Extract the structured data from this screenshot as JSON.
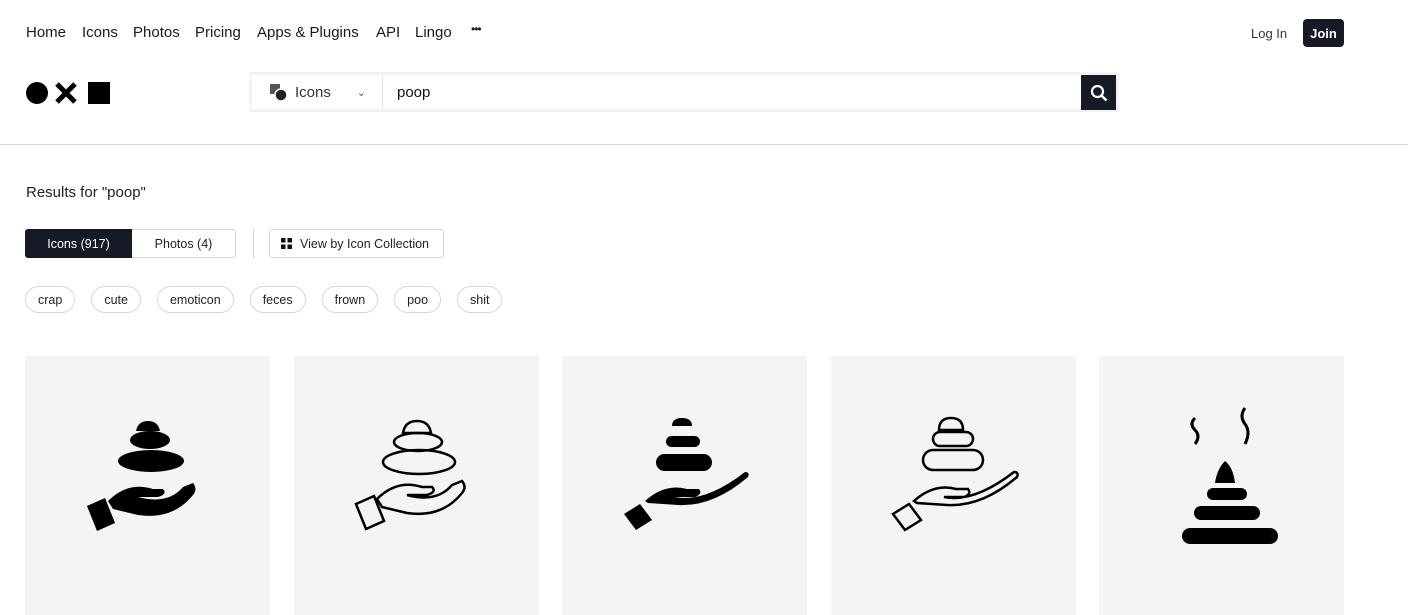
{
  "nav": {
    "items": [
      "Home",
      "Icons",
      "Photos",
      "Pricing",
      "Apps & Plugins",
      "API",
      "Lingo"
    ],
    "more": "•••",
    "login": "Log In",
    "join": "Join"
  },
  "search": {
    "type": "Icons",
    "query": "poop"
  },
  "results": {
    "heading": "Results for \"poop\"",
    "tabs": [
      "Icons (917)",
      "Photos (4)"
    ],
    "collection": "View by Icon Collection"
  },
  "tags": [
    "crap",
    "cute",
    "emoticon",
    "feces",
    "frown",
    "poo",
    "shit"
  ],
  "colors": {
    "dark": "#161a26",
    "card_bg": "#f4f4f6"
  }
}
